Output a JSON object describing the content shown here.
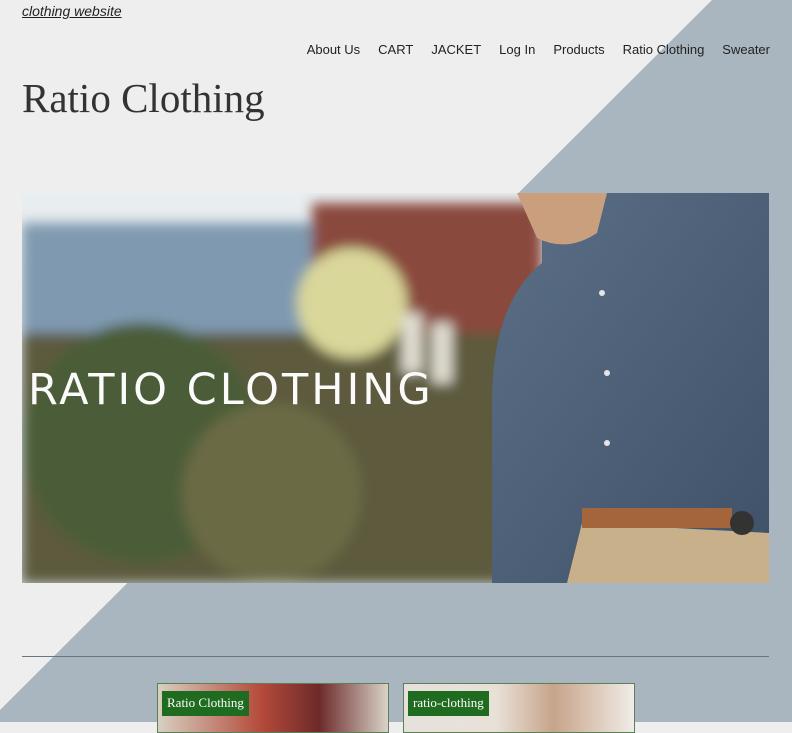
{
  "site": {
    "link_text": "clothing website",
    "title": "Ratio Clothing"
  },
  "nav": {
    "items": [
      {
        "label": "About Us"
      },
      {
        "label": "CART"
      },
      {
        "label": "JACKET"
      },
      {
        "label": "Log In"
      },
      {
        "label": "Products"
      },
      {
        "label": "Ratio Clothing"
      },
      {
        "label": "Sweater"
      }
    ]
  },
  "hero": {
    "overlay_text": "RATIO CLOTHING"
  },
  "cards": [
    {
      "label": "Ratio Clothing"
    },
    {
      "label": "ratio-clothing"
    }
  ],
  "colors": {
    "background": "#eeeeee",
    "diagonal": "#a9b6c0",
    "badge": "#1f6b20"
  }
}
